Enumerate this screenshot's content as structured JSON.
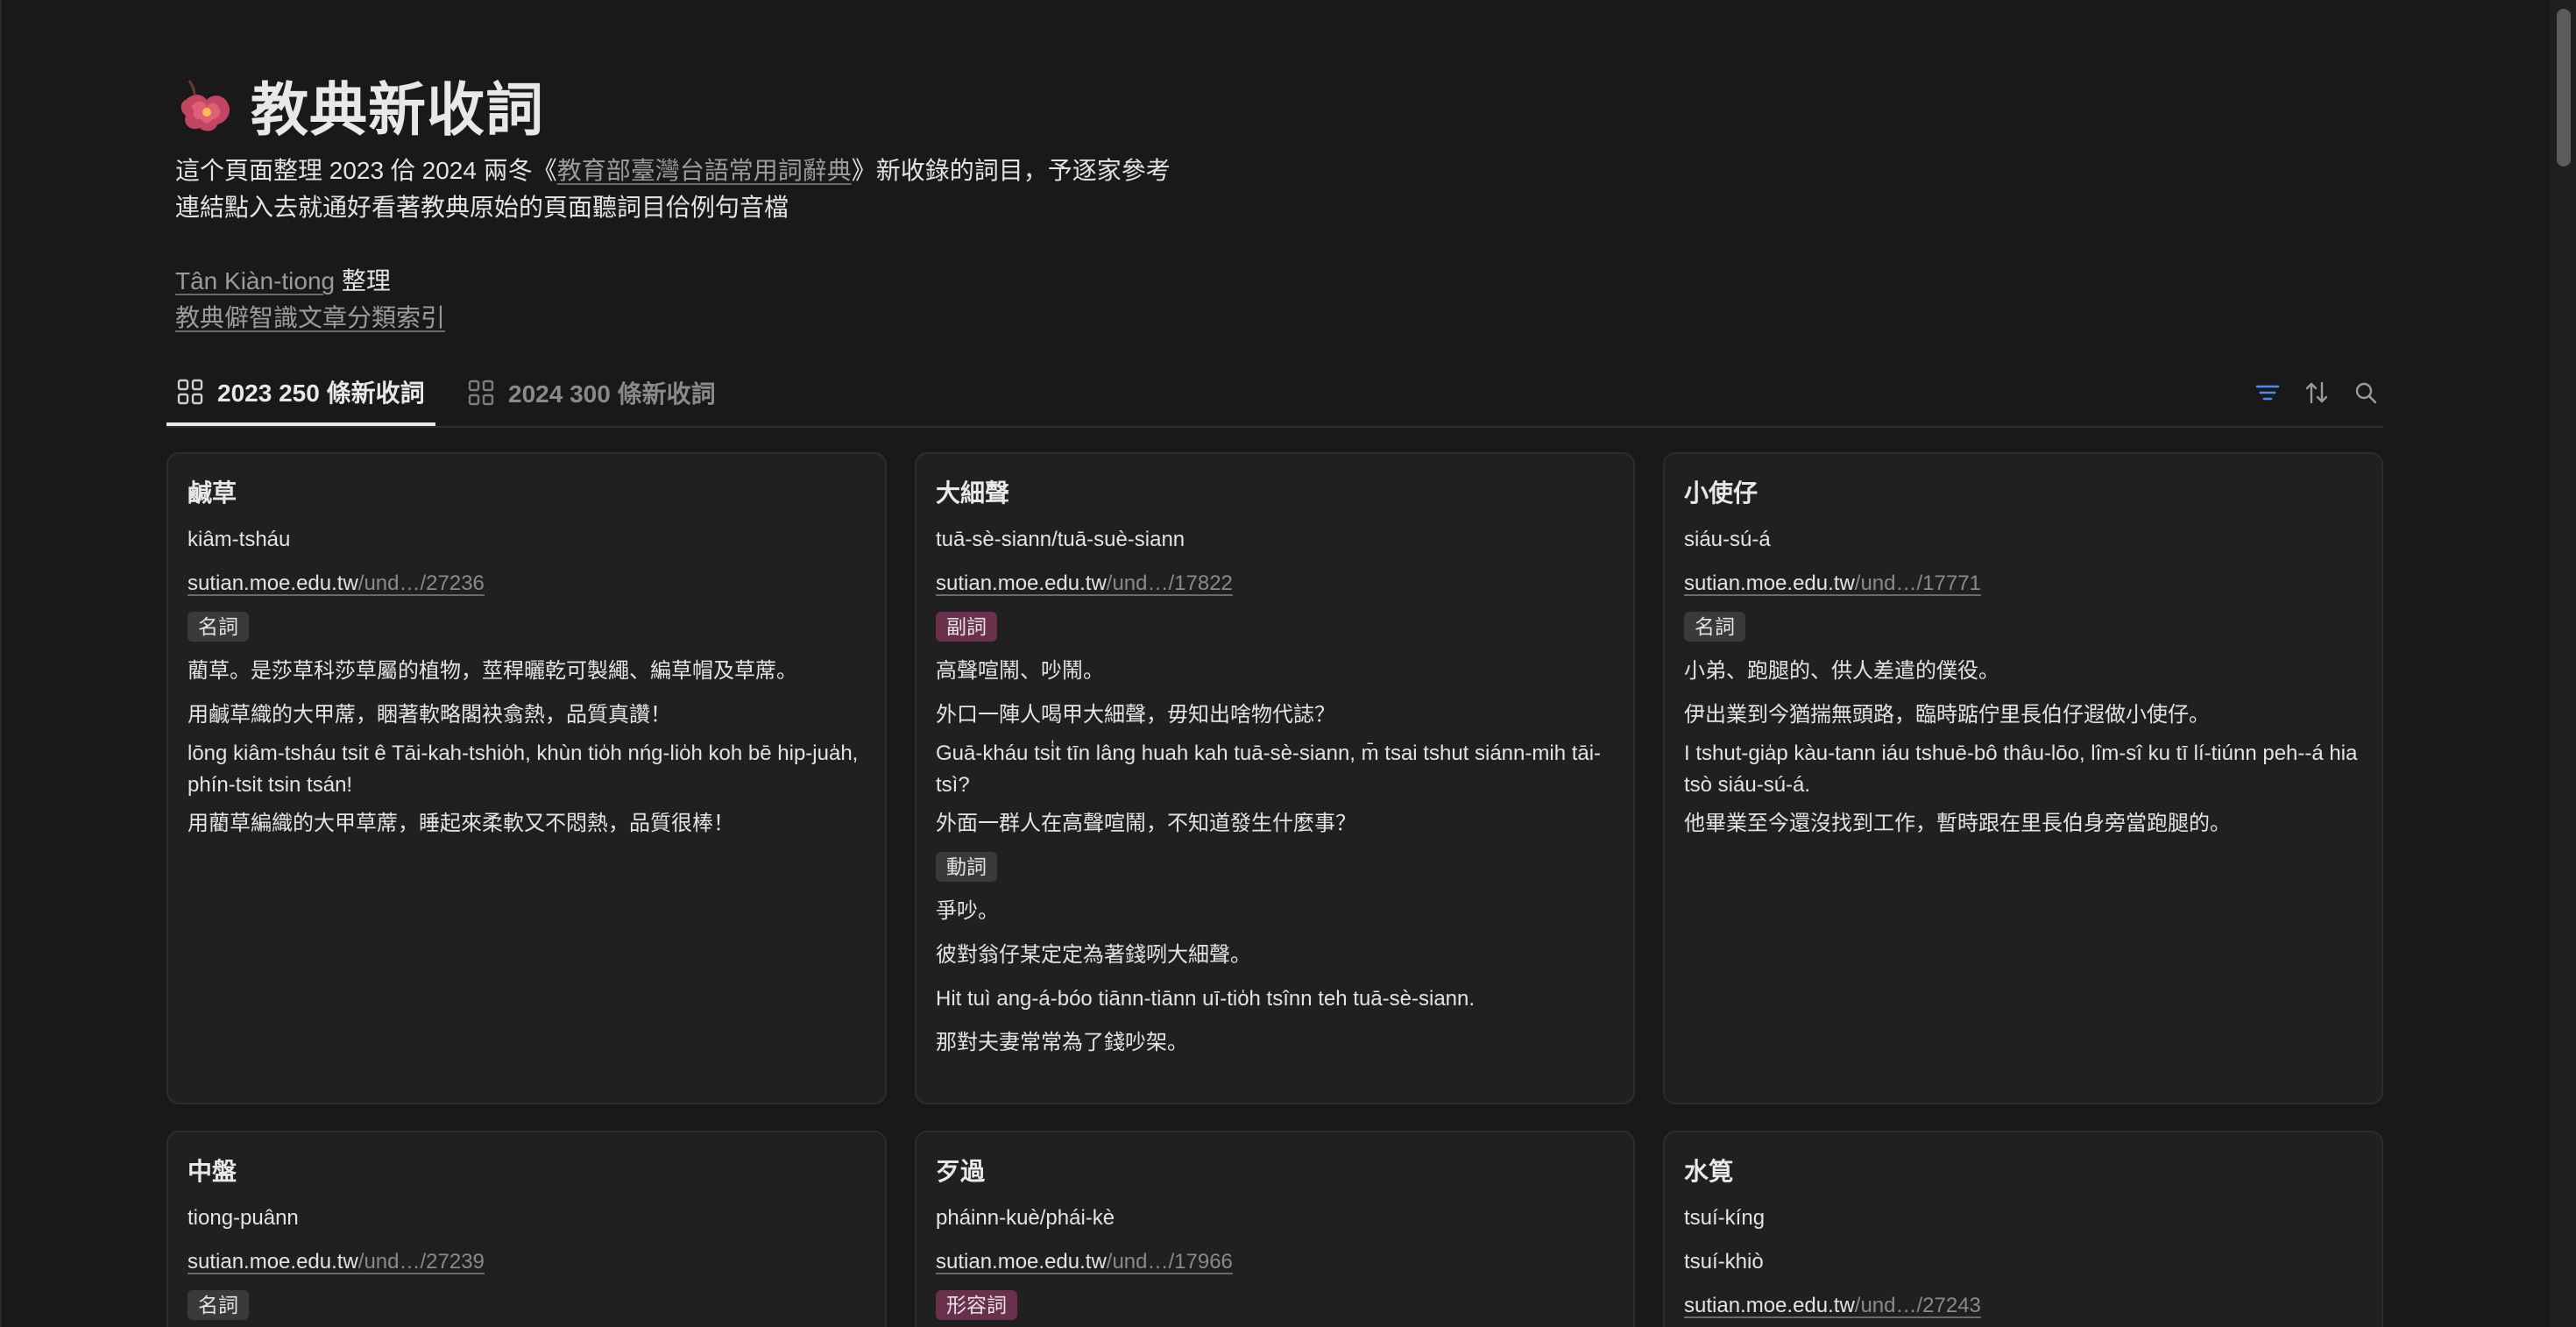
{
  "page": {
    "title": "教典新收詞",
    "icon": "plum-blossom-icon",
    "description_lines": [
      {
        "before": "這个頁面整理 2023 佮 2024 兩冬《",
        "link": "教育部臺灣台語常用詞辭典",
        "after": "》新收錄的詞目，予逐家參考"
      },
      {
        "text": "連結點入去就通好看著教典原始的頁面聽詞目佮例句音檔"
      }
    ],
    "credits": {
      "author_link": "Tân Kiàn-tiong",
      "author_suffix": " 整理",
      "index_link": "教典僻智識文章分類索引"
    }
  },
  "tabs": [
    {
      "label": "2023 250 條新收詞",
      "active": true
    },
    {
      "label": "2024 300 條新收詞",
      "active": false
    }
  ],
  "toolbar": {
    "filter_icon": "filter-icon",
    "sort_icon": "sort-icon",
    "search_icon": "search-icon",
    "accent_color": "#4a8ff0"
  },
  "tag_colors": {
    "gray": "#3a3a3a",
    "pink": "#69314c"
  },
  "cards": [
    {
      "title": "鹹草",
      "romanization": [
        "kiâm-tsháu"
      ],
      "url_domain": "sutian.moe.edu.tw",
      "url_path": "/und…/27236",
      "senses": [
        {
          "pos": "名詞",
          "pos_color": "gray",
          "lines": [
            "藺草。是莎草科莎草屬的植物，莖稈曬乾可製繩、編草帽及草蓆。",
            "用鹹草織的大甲蓆，睏著軟略閣袂翕熱，品質真讚！",
            "lōng kiâm-tsháu tsit ê Tāi-kah-tshio̍h, khùn tio̍h nńg-lio̍h koh bē hip-jua̍h, phín-tsit tsin tsán!",
            "用藺草編織的大甲草蓆，睡起來柔軟又不悶熱，品質很棒！"
          ]
        }
      ]
    },
    {
      "title": "大細聲",
      "romanization": [
        "tuā-sè-siann/tuā-suè-siann"
      ],
      "url_domain": "sutian.moe.edu.tw",
      "url_path": "/und…/17822",
      "senses": [
        {
          "pos": "副詞",
          "pos_color": "pink",
          "lines": [
            "高聲喧鬧、吵鬧。",
            "外口一陣人喝甲大細聲，毋知出啥物代誌？",
            "Guā-kháu tsi̍t tīn lâng huah kah tuā-sè-siann, m̄ tsai tshut siánn-mih tāi-tsì?",
            "外面一群人在高聲喧鬧，不知道發生什麼事？"
          ]
        },
        {
          "pos": "動詞",
          "pos_color": "gray",
          "lines": [
            "爭吵。",
            "彼對翁仔某定定為著錢咧大細聲。",
            "Hit tuì ang-á-bóo tiānn-tiānn uī-tio̍h tsînn teh tuā-sè-siann.",
            "那對夫妻常常為了錢吵架。"
          ]
        }
      ]
    },
    {
      "title": "小使仔",
      "romanization": [
        "siáu-sú-á"
      ],
      "url_domain": "sutian.moe.edu.tw",
      "url_path": "/und…/17771",
      "senses": [
        {
          "pos": "名詞",
          "pos_color": "gray",
          "lines": [
            "小弟、跑腿的、供人差遣的僕役。",
            "伊出業到今猶揣無頭路，臨時踮佇里長伯仔遐做小使仔。",
            "I tshut-gia̍p kàu-tann iáu tshuē-bô thâu-lōo, lîm-sî ku tī lí-tiúnn peh--á hia tsò siáu-sú-á.",
            "他畢業至今還沒找到工作，暫時跟在里長伯身旁當跑腿的。"
          ]
        }
      ]
    },
    {
      "title": "中盤",
      "romanization": [
        "tiong-puânn"
      ],
      "url_domain": "sutian.moe.edu.tw",
      "url_path": "/und…/27239",
      "senses": [
        {
          "pos": "名詞",
          "pos_color": "gray",
          "lines": []
        }
      ]
    },
    {
      "title": "歹過",
      "romanization": [
        "pháinn-kuè/phái-kè"
      ],
      "url_domain": "sutian.moe.edu.tw",
      "url_path": "/und…/17966",
      "senses": [
        {
          "pos": "形容詞",
          "pos_color": "pink",
          "lines": []
        }
      ]
    },
    {
      "title": "水筧",
      "romanization": [
        "tsuí-kíng",
        "tsuí-khiò"
      ],
      "url_domain": "sutian.moe.edu.tw",
      "url_path": "/und…/27243",
      "senses": []
    }
  ]
}
